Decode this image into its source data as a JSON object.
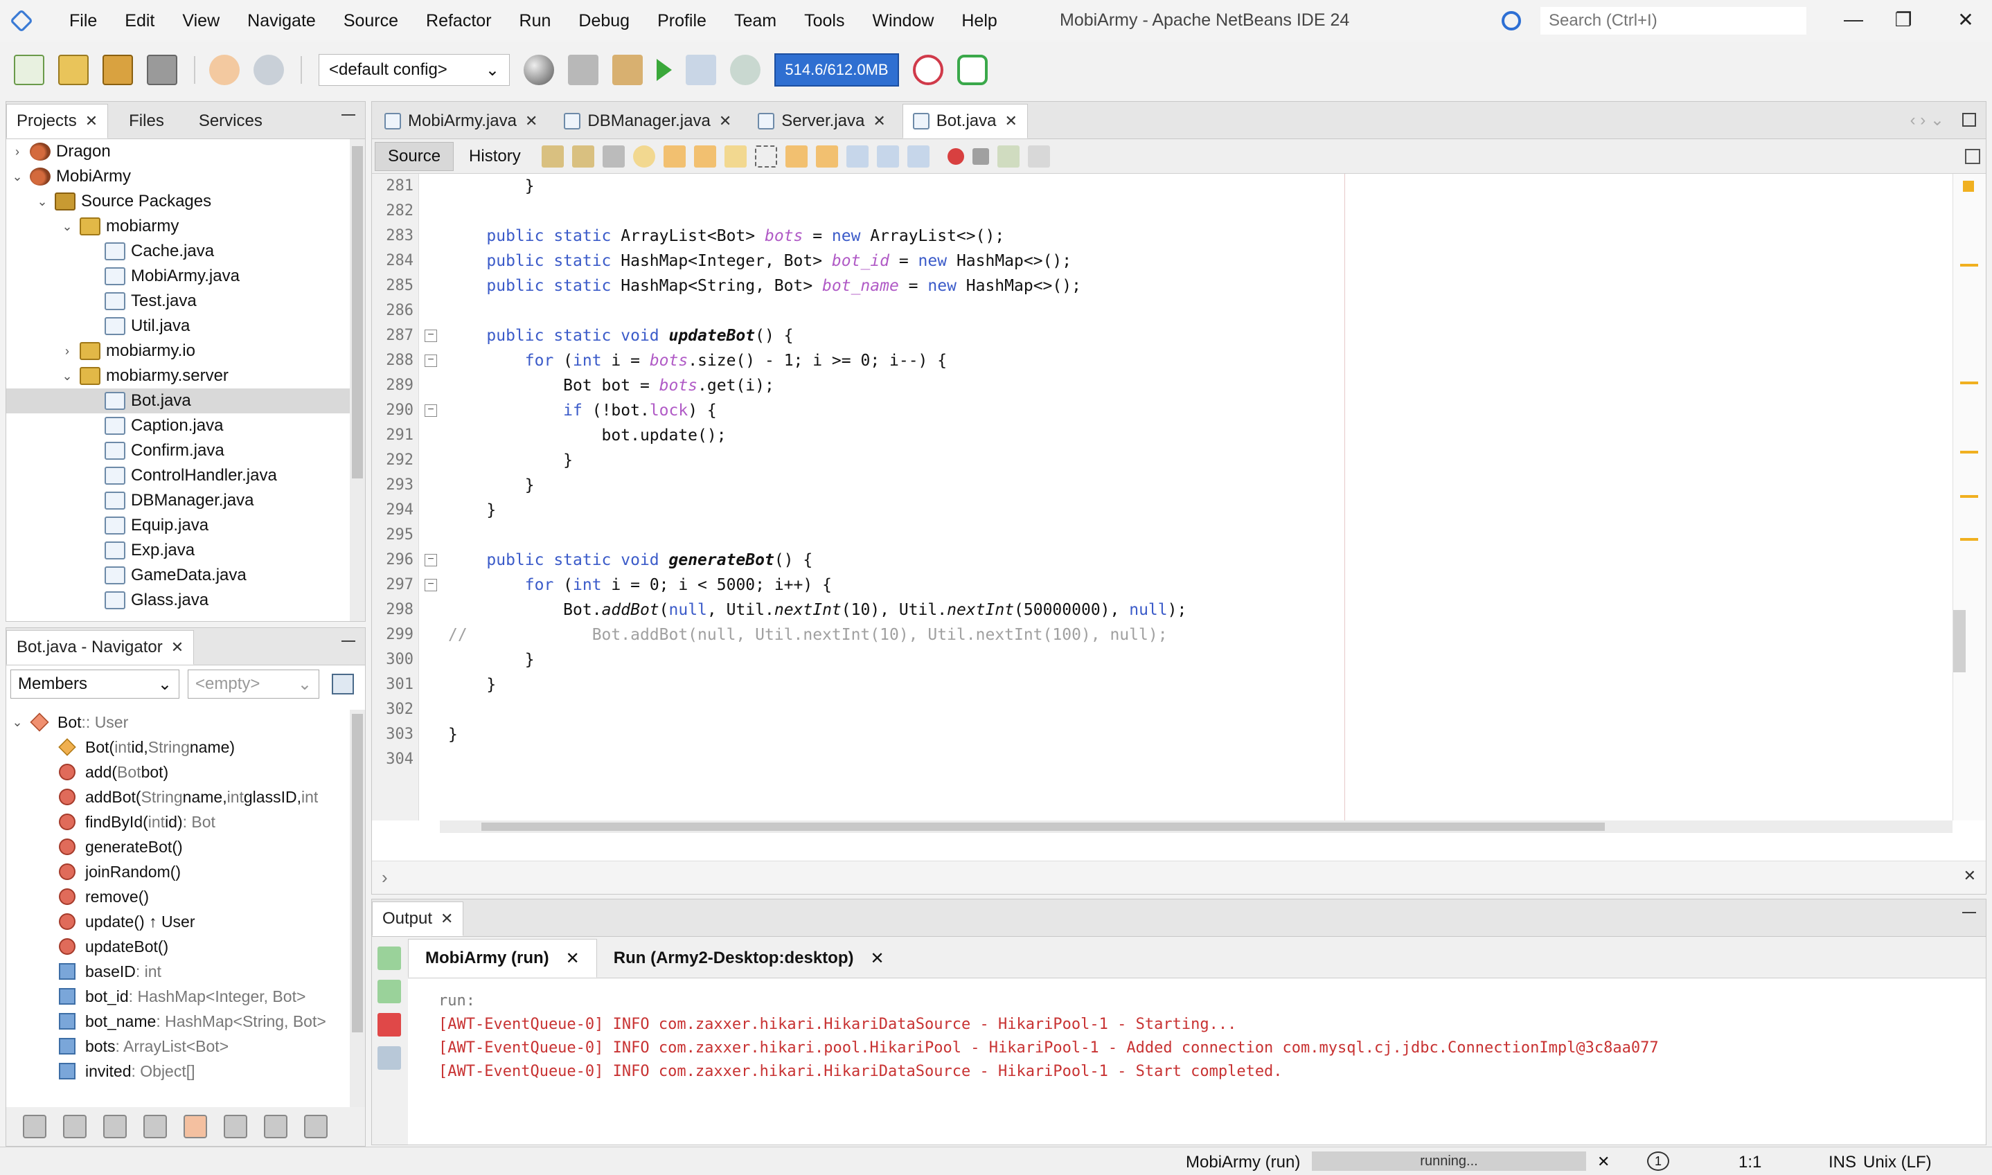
{
  "window": {
    "title": "MobiArmy - Apache NetBeans IDE 24",
    "minimize": "—",
    "maximize": "❐",
    "close": "✕"
  },
  "menu": [
    "File",
    "Edit",
    "View",
    "Navigate",
    "Source",
    "Refactor",
    "Run",
    "Debug",
    "Profile",
    "Team",
    "Tools",
    "Window",
    "Help"
  ],
  "search": {
    "placeholder": "Search (Ctrl+I)"
  },
  "toolbar": {
    "config": "<default config>",
    "memory": "514.6/612.0MB"
  },
  "projects": {
    "tabs": [
      "Projects",
      "Files",
      "Services"
    ],
    "tree": [
      {
        "label": "Dragon",
        "level": 0,
        "twisty": "›",
        "icon": "project-icon"
      },
      {
        "label": "MobiArmy",
        "level": 0,
        "twisty": "⌄",
        "icon": "project-icon"
      },
      {
        "label": "Source Packages",
        "level": 1,
        "twisty": "⌄",
        "icon": "source-packages-icon"
      },
      {
        "label": "mobiarmy",
        "level": 2,
        "twisty": "⌄",
        "icon": "package-icon"
      },
      {
        "label": "Cache.java",
        "level": 3,
        "twisty": "",
        "icon": "java-file-icon"
      },
      {
        "label": "MobiArmy.java",
        "level": 3,
        "twisty": "",
        "icon": "java-file-icon"
      },
      {
        "label": "Test.java",
        "level": 3,
        "twisty": "",
        "icon": "java-file-icon"
      },
      {
        "label": "Util.java",
        "level": 3,
        "twisty": "",
        "icon": "java-file-icon"
      },
      {
        "label": "mobiarmy.io",
        "level": 2,
        "twisty": "›",
        "icon": "package-icon"
      },
      {
        "label": "mobiarmy.server",
        "level": 2,
        "twisty": "⌄",
        "icon": "package-icon"
      },
      {
        "label": "Bot.java",
        "level": 3,
        "twisty": "",
        "icon": "java-file-icon",
        "selected": true
      },
      {
        "label": "Caption.java",
        "level": 3,
        "twisty": "",
        "icon": "java-file-icon"
      },
      {
        "label": "Confirm.java",
        "level": 3,
        "twisty": "",
        "icon": "java-file-icon"
      },
      {
        "label": "ControlHandler.java",
        "level": 3,
        "twisty": "",
        "icon": "java-file-icon"
      },
      {
        "label": "DBManager.java",
        "level": 3,
        "twisty": "",
        "icon": "java-file-icon"
      },
      {
        "label": "Equip.java",
        "level": 3,
        "twisty": "",
        "icon": "java-file-icon"
      },
      {
        "label": "Exp.java",
        "level": 3,
        "twisty": "",
        "icon": "java-file-icon"
      },
      {
        "label": "GameData.java",
        "level": 3,
        "twisty": "",
        "icon": "java-file-icon"
      },
      {
        "label": "Glass.java",
        "level": 3,
        "twisty": "",
        "icon": "java-file-icon"
      }
    ]
  },
  "navigator": {
    "title": "Bot.java - Navigator",
    "filter": "Members",
    "filter2": "<empty>",
    "root": {
      "name": "Bot",
      "suffix": " :: User"
    },
    "members": [
      {
        "kind": "ctor",
        "name": "Bot(",
        "rest": [
          [
            "int",
            " id, "
          ],
          [
            "String",
            " name)"
          ]
        ]
      },
      {
        "kind": "method",
        "name": "add(",
        "rest": [
          [
            "Bot",
            " bot)"
          ]
        ]
      },
      {
        "kind": "method",
        "name": "addBot(",
        "rest": [
          [
            "String",
            " name, "
          ],
          [
            "int",
            " glassID, "
          ],
          [
            "int",
            ""
          ]
        ]
      },
      {
        "kind": "method",
        "name": "findById(",
        "rest": [
          [
            "int",
            " id) "
          ],
          [
            ": Bot",
            ""
          ]
        ]
      },
      {
        "kind": "method",
        "name": "generateBot()",
        "rest": []
      },
      {
        "kind": "method",
        "name": "joinRandom()",
        "rest": []
      },
      {
        "kind": "method",
        "name": "remove()",
        "rest": []
      },
      {
        "kind": "method",
        "name": "update() ↑ User",
        "rest": []
      },
      {
        "kind": "method",
        "name": "updateBot()",
        "rest": []
      },
      {
        "kind": "field",
        "name": "baseID",
        "rest": [
          [
            " : int",
            ""
          ]
        ]
      },
      {
        "kind": "field",
        "name": "bot_id",
        "rest": [
          [
            " : HashMap<Integer, Bot>",
            ""
          ]
        ]
      },
      {
        "kind": "field",
        "name": "bot_name",
        "rest": [
          [
            " : HashMap<String, Bot>",
            ""
          ]
        ]
      },
      {
        "kind": "field",
        "name": "bots",
        "rest": [
          [
            " : ArrayList<Bot>",
            ""
          ]
        ]
      },
      {
        "kind": "field",
        "name": "invited",
        "rest": [
          [
            " : Object[]",
            ""
          ]
        ]
      }
    ]
  },
  "editor": {
    "tabs": [
      "MobiArmy.java",
      "DBManager.java",
      "Server.java",
      "Bot.java"
    ],
    "active_tab": 3,
    "modes": [
      "Source",
      "History"
    ],
    "lines": [
      {
        "n": "281",
        "html": "        }"
      },
      {
        "n": "282",
        "html": ""
      },
      {
        "n": "283",
        "html": "    <span class=\"kw\">public static</span> ArrayList&lt;Bot&gt; <span class=\"fld\">bots</span> = <span class=\"kw\">new</span> ArrayList&lt;&gt;();"
      },
      {
        "n": "284",
        "html": "    <span class=\"kw\">public static</span> HashMap&lt;Integer, Bot&gt; <span class=\"fld\">bot_id</span> = <span class=\"kw\">new</span> HashMap&lt;&gt;();"
      },
      {
        "n": "285",
        "html": "    <span class=\"kw\">public static</span> HashMap&lt;String, Bot&gt; <span class=\"fld\">bot_name</span> = <span class=\"kw\">new</span> HashMap&lt;&gt;();"
      },
      {
        "n": "286",
        "html": ""
      },
      {
        "n": "287",
        "html": "    <span class=\"kw\">public static void</span> <span class=\"mth\">updateBot</span>() {",
        "fold": true
      },
      {
        "n": "288",
        "html": "        <span class=\"kw\">for</span> (<span class=\"kw\">int</span> i = <span class=\"fld\">bots</span>.size() - 1; i &gt;= 0; i--) {",
        "fold": true
      },
      {
        "n": "289",
        "html": "            Bot bot = <span class=\"fld\">bots</span>.get(i);"
      },
      {
        "n": "290",
        "html": "            <span class=\"kw\">if</span> (!bot.<span class=\"fld\" style=\"font-style:normal\">lock</span>) {",
        "fold": true
      },
      {
        "n": "291",
        "html": "                bot.update();"
      },
      {
        "n": "292",
        "html": "            }"
      },
      {
        "n": "293",
        "html": "        }"
      },
      {
        "n": "294",
        "html": "    }"
      },
      {
        "n": "295",
        "html": ""
      },
      {
        "n": "296",
        "html": "    <span class=\"kw\">public static void</span> <span class=\"mth\">generateBot</span>() {",
        "fold": true
      },
      {
        "n": "297",
        "html": "        <span class=\"kw\">for</span> (<span class=\"kw\">int</span> i = 0; i &lt; 5000; i++) {",
        "fold": true
      },
      {
        "n": "298",
        "html": "            Bot.<span class=\"it\">addBot</span>(<span class=\"kw\">null</span>, Util.<span class=\"it\">nextInt</span>(10), Util.<span class=\"it\">nextInt</span>(50000000), <span class=\"kw\">null</span>);"
      },
      {
        "n": "299",
        "html": "<span class=\"cmt\">//             Bot.addBot(null, Util.nextInt(10), Util.nextInt(100), null);</span>"
      },
      {
        "n": "300",
        "html": "        }"
      },
      {
        "n": "301",
        "html": "    }"
      },
      {
        "n": "302",
        "html": ""
      },
      {
        "n": "303",
        "html": "}"
      },
      {
        "n": "304",
        "html": ""
      }
    ]
  },
  "output": {
    "title": "Output",
    "tabs": [
      "MobiArmy (run)",
      "Run (Army2-Desktop:desktop)"
    ],
    "lines": [
      {
        "cls": "out-run",
        "text": "run:"
      },
      {
        "cls": "out-err",
        "text": "[AWT-EventQueue-0] INFO com.zaxxer.hikari.HikariDataSource - HikariPool-1 - Starting..."
      },
      {
        "cls": "out-err",
        "text": "[AWT-EventQueue-0] INFO com.zaxxer.hikari.pool.HikariPool - HikariPool-1 - Added connection com.mysql.cj.jdbc.ConnectionImpl@3c8aa077"
      },
      {
        "cls": "out-err",
        "text": "[AWT-EventQueue-0] INFO com.zaxxer.hikari.HikariDataSource - HikariPool-1 - Start completed."
      }
    ]
  },
  "status": {
    "task": "MobiArmy (run)",
    "progress": "running...",
    "notifications": "1",
    "position": "1:1",
    "insert_mode": "INS",
    "line_ending": "Unix (LF)"
  }
}
